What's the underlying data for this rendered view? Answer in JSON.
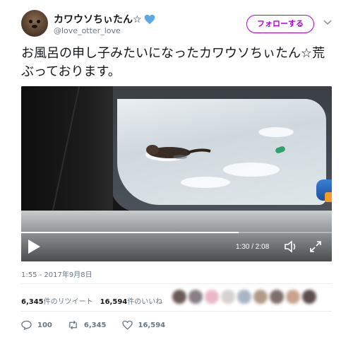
{
  "user": {
    "display_name": "カワウソちぃたん☆",
    "handle": "@love_otter_love"
  },
  "follow_button": {
    "label": "フォローする",
    "color": "#b300d9"
  },
  "tweet": {
    "text": "お風呂の申し子みたいになったカワウソちぃたん☆荒ぶっております。"
  },
  "video": {
    "time_readout": "1:30 / 2:08",
    "progress_fraction": 0.7
  },
  "timestamp": "1:55 - 2017年9月8日",
  "stats": {
    "retweets_count": "6,345",
    "retweets_label": "件のリツイート",
    "likes_count": "16,594",
    "likes_label": "件のいいね"
  },
  "actions": {
    "reply_count": "100",
    "retweet_count": "6,345",
    "like_count": "16,594"
  },
  "icons": {
    "heart": "heart-icon",
    "caret": "caret-down-icon",
    "play": "play-icon",
    "volume": "volume-icon",
    "fullscreen": "fullscreen-icon",
    "reply": "reply-icon",
    "retweet": "retweet-icon",
    "like": "like-icon"
  },
  "colors": {
    "accent": "#b300d9",
    "heart": "#5aa9e6",
    "muted": "#657786"
  }
}
